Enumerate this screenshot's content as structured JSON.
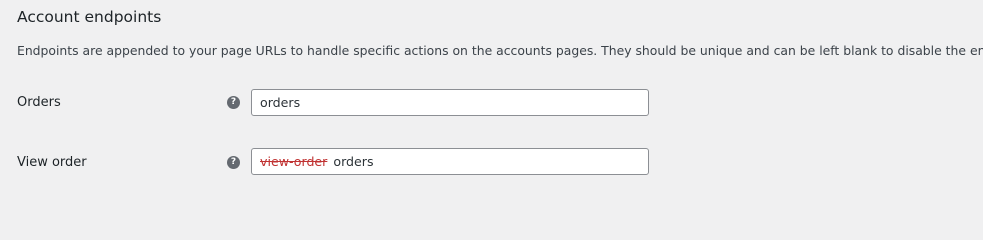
{
  "section": {
    "title": "Account endpoints",
    "description": "Endpoints are appended to your page URLs to handle specific actions on the accounts pages. They should be unique and can be left blank to disable the endpoint."
  },
  "rows": [
    {
      "label": "Orders",
      "help_icon": "question-mark",
      "value": "orders"
    },
    {
      "label": "View order",
      "help_icon": "question-mark",
      "old_value": "view-order",
      "value": "orders"
    }
  ],
  "colors": {
    "strike": "#c03232",
    "help_icon_bg": "#646970"
  }
}
